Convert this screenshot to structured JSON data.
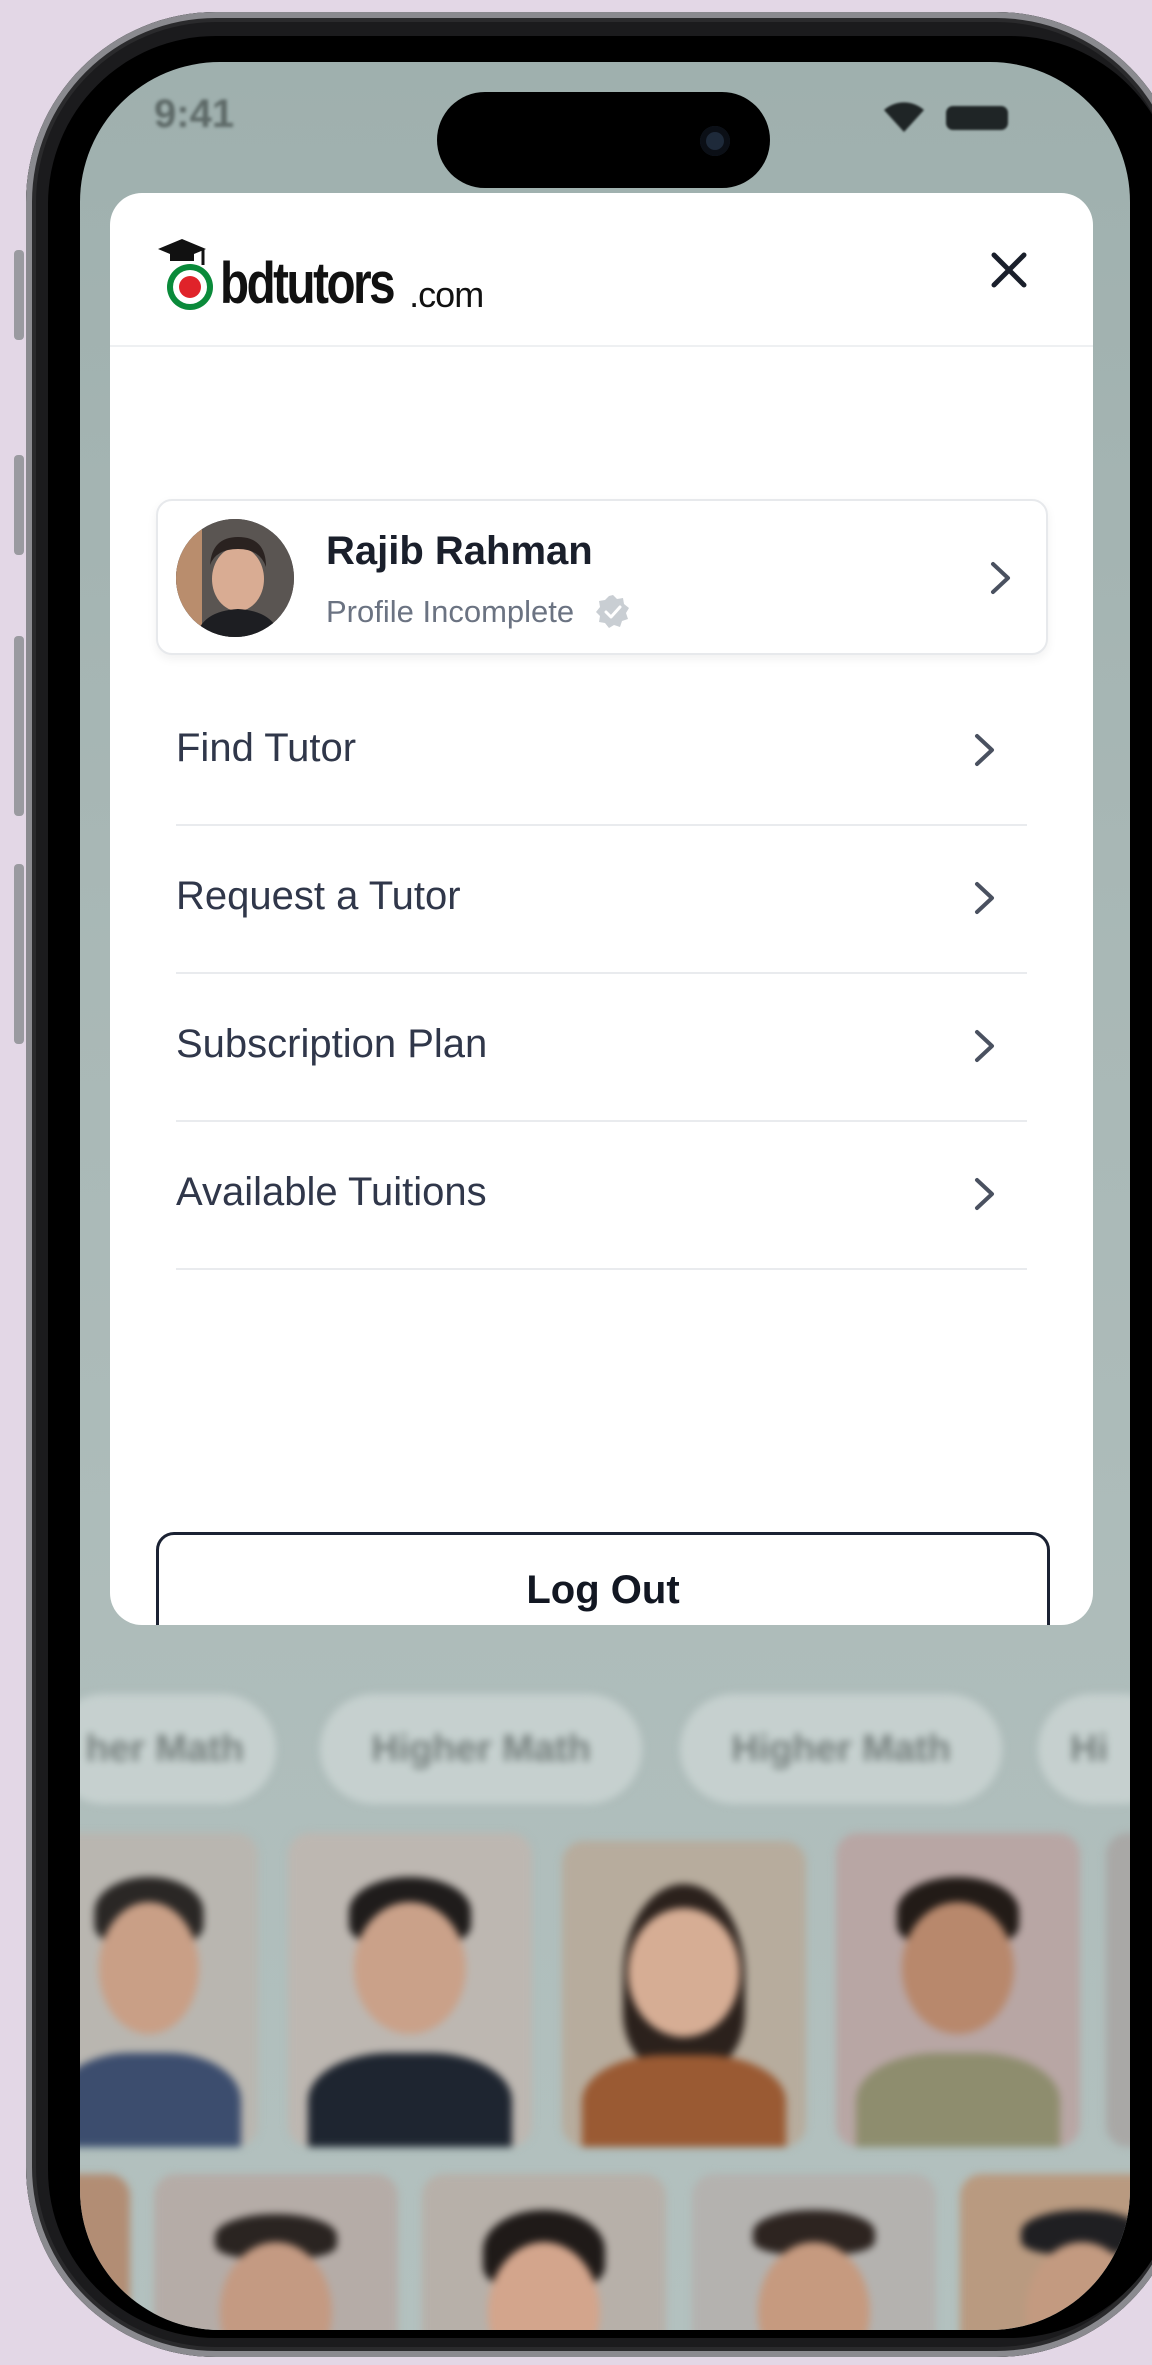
{
  "status_bar": {
    "time": "9:41"
  },
  "header": {
    "logo_text": "bdtutors",
    "logo_suffix": ".com",
    "close_icon": "close-icon"
  },
  "profile": {
    "name": "Rajib Rahman",
    "status": "Profile Incomplete",
    "status_icon": "verified-badge-icon"
  },
  "menu": {
    "items": [
      {
        "label": "Find Tutor"
      },
      {
        "label": "Request a Tutor"
      },
      {
        "label": "Subscription Plan"
      },
      {
        "label": "Available Tuitions"
      }
    ]
  },
  "logout": {
    "label": "Log Out"
  },
  "background": {
    "chips": [
      "her Math",
      "Higher Math",
      "Higher Math",
      "Hi"
    ]
  },
  "colors": {
    "page_bg": "#e3d7e6",
    "screen_overlay": "#a9b8b6",
    "text_primary": "#1a1f2b",
    "text_secondary": "#6b7382",
    "logo_red": "#e0232a",
    "logo_green": "#0a8a3a"
  }
}
